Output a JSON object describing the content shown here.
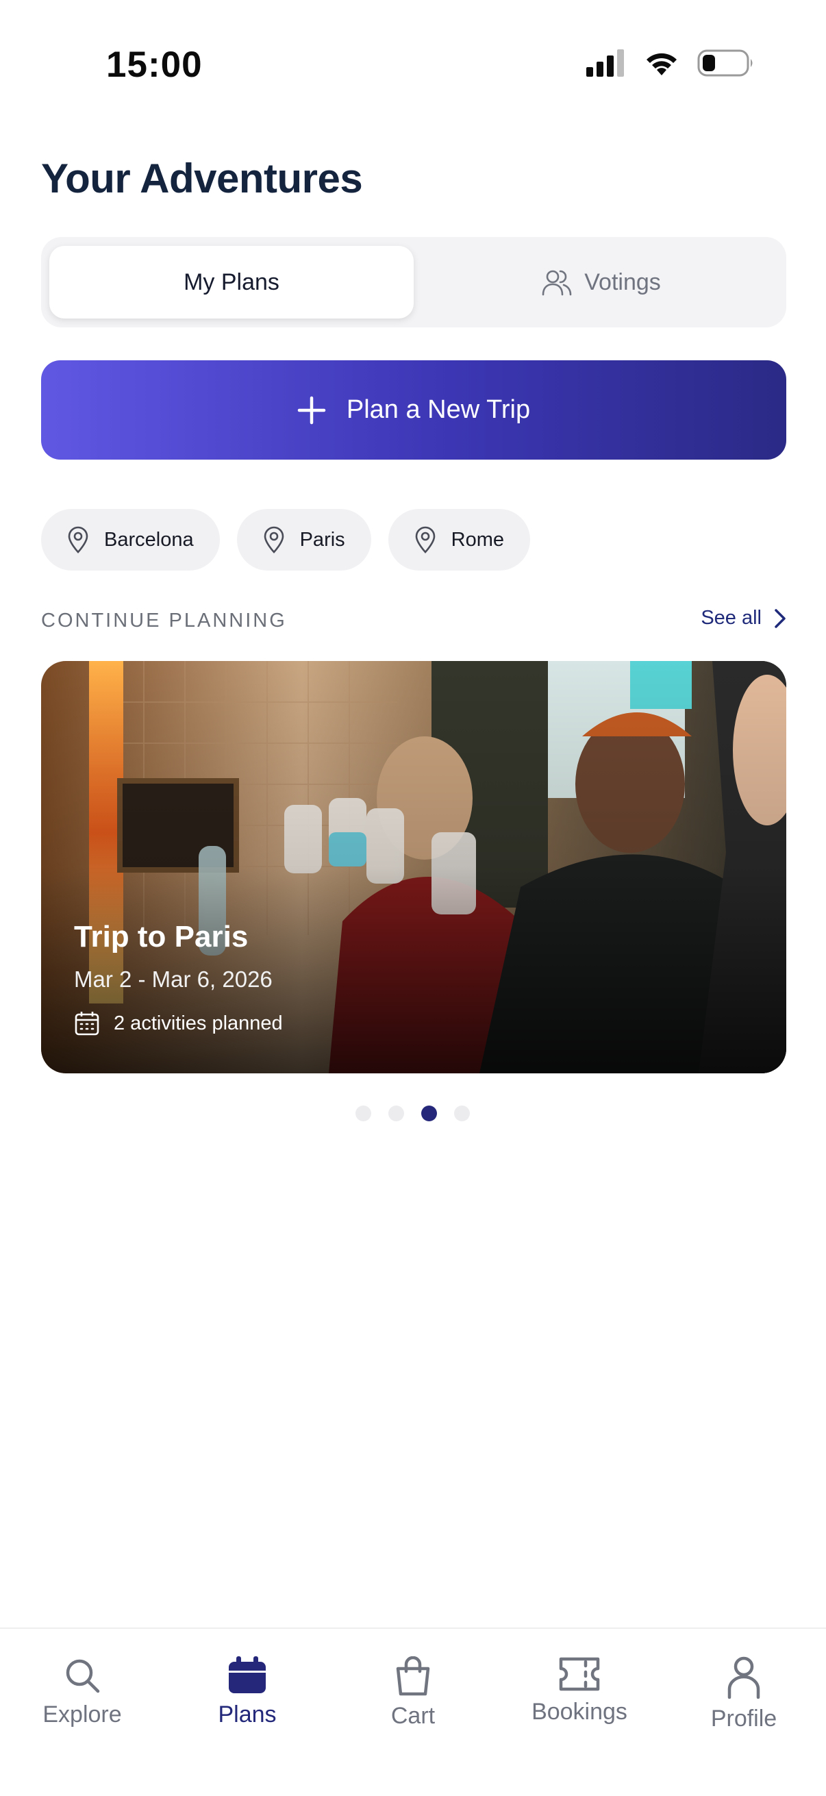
{
  "status_bar": {
    "time": "15:00",
    "signal_icon": "signal-icon",
    "wifi_icon": "wifi-icon",
    "battery_icon": "battery-icon"
  },
  "page": {
    "title": "Your Adventures"
  },
  "segmented": {
    "tabs": [
      {
        "label": "My Plans",
        "active": true
      },
      {
        "label": "Votings",
        "icon": "people-icon",
        "active": false
      }
    ]
  },
  "cta": {
    "label": "Plan a New Trip",
    "icon": "plus-icon"
  },
  "chips": [
    {
      "label": "Barcelona",
      "icon": "map-pin-icon"
    },
    {
      "label": "Paris",
      "icon": "map-pin-icon"
    },
    {
      "label": "Rome",
      "icon": "map-pin-icon"
    }
  ],
  "section": {
    "label": "CONTINUE PLANNING",
    "see_all": "See all"
  },
  "trip_card": {
    "title": "Trip to Paris",
    "dates": "Mar 2 - Mar 6, 2026",
    "activities": "2 activities planned",
    "icon": "calendar-icon"
  },
  "pager": {
    "count": 4,
    "active_index": 2
  },
  "bottom_nav": [
    {
      "label": "Explore",
      "icon": "search-icon",
      "active": false
    },
    {
      "label": "Plans",
      "icon": "calendar-icon",
      "active": true
    },
    {
      "label": "Cart",
      "icon": "shopping-bag-icon",
      "active": false
    },
    {
      "label": "Bookings",
      "icon": "ticket-icon",
      "active": false
    },
    {
      "label": "Profile",
      "icon": "user-icon",
      "active": false
    }
  ],
  "colors": {
    "accent": "#23287a",
    "cta_start": "#6057e3",
    "cta_end": "#2b2a86",
    "title": "#14243f"
  }
}
